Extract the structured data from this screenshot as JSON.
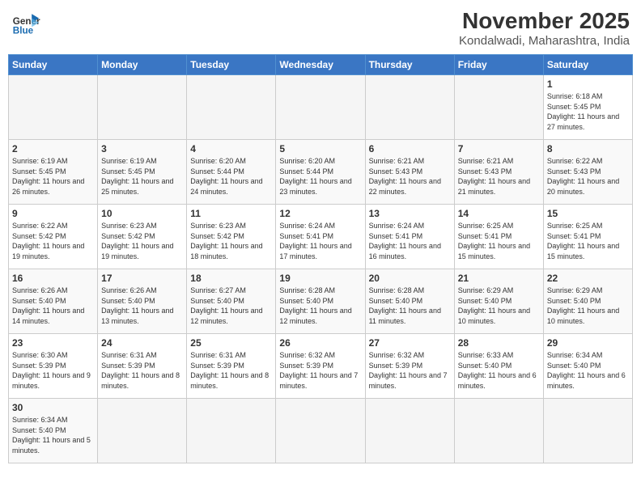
{
  "logo": {
    "text_general": "General",
    "text_blue": "Blue"
  },
  "title": "November 2025",
  "location": "Kondalwadi, Maharashtra, India",
  "weekdays": [
    "Sunday",
    "Monday",
    "Tuesday",
    "Wednesday",
    "Thursday",
    "Friday",
    "Saturday"
  ],
  "weeks": [
    [
      {
        "day": "",
        "empty": true
      },
      {
        "day": "",
        "empty": true
      },
      {
        "day": "",
        "empty": true
      },
      {
        "day": "",
        "empty": true
      },
      {
        "day": "",
        "empty": true
      },
      {
        "day": "",
        "empty": true
      },
      {
        "day": "1",
        "info": "Sunrise: 6:18 AM\nSunset: 5:45 PM\nDaylight: 11 hours\nand 27 minutes."
      }
    ],
    [
      {
        "day": "2",
        "info": "Sunrise: 6:19 AM\nSunset: 5:45 PM\nDaylight: 11 hours\nand 26 minutes."
      },
      {
        "day": "3",
        "info": "Sunrise: 6:19 AM\nSunset: 5:45 PM\nDaylight: 11 hours\nand 25 minutes."
      },
      {
        "day": "4",
        "info": "Sunrise: 6:20 AM\nSunset: 5:44 PM\nDaylight: 11 hours\nand 24 minutes."
      },
      {
        "day": "5",
        "info": "Sunrise: 6:20 AM\nSunset: 5:44 PM\nDaylight: 11 hours\nand 23 minutes."
      },
      {
        "day": "6",
        "info": "Sunrise: 6:21 AM\nSunset: 5:43 PM\nDaylight: 11 hours\nand 22 minutes."
      },
      {
        "day": "7",
        "info": "Sunrise: 6:21 AM\nSunset: 5:43 PM\nDaylight: 11 hours\nand 21 minutes."
      },
      {
        "day": "8",
        "info": "Sunrise: 6:22 AM\nSunset: 5:43 PM\nDaylight: 11 hours\nand 20 minutes."
      }
    ],
    [
      {
        "day": "9",
        "info": "Sunrise: 6:22 AM\nSunset: 5:42 PM\nDaylight: 11 hours\nand 19 minutes."
      },
      {
        "day": "10",
        "info": "Sunrise: 6:23 AM\nSunset: 5:42 PM\nDaylight: 11 hours\nand 19 minutes."
      },
      {
        "day": "11",
        "info": "Sunrise: 6:23 AM\nSunset: 5:42 PM\nDaylight: 11 hours\nand 18 minutes."
      },
      {
        "day": "12",
        "info": "Sunrise: 6:24 AM\nSunset: 5:41 PM\nDaylight: 11 hours\nand 17 minutes."
      },
      {
        "day": "13",
        "info": "Sunrise: 6:24 AM\nSunset: 5:41 PM\nDaylight: 11 hours\nand 16 minutes."
      },
      {
        "day": "14",
        "info": "Sunrise: 6:25 AM\nSunset: 5:41 PM\nDaylight: 11 hours\nand 15 minutes."
      },
      {
        "day": "15",
        "info": "Sunrise: 6:25 AM\nSunset: 5:41 PM\nDaylight: 11 hours\nand 15 minutes."
      }
    ],
    [
      {
        "day": "16",
        "info": "Sunrise: 6:26 AM\nSunset: 5:40 PM\nDaylight: 11 hours\nand 14 minutes."
      },
      {
        "day": "17",
        "info": "Sunrise: 6:26 AM\nSunset: 5:40 PM\nDaylight: 11 hours\nand 13 minutes."
      },
      {
        "day": "18",
        "info": "Sunrise: 6:27 AM\nSunset: 5:40 PM\nDaylight: 11 hours\nand 12 minutes."
      },
      {
        "day": "19",
        "info": "Sunrise: 6:28 AM\nSunset: 5:40 PM\nDaylight: 11 hours\nand 12 minutes."
      },
      {
        "day": "20",
        "info": "Sunrise: 6:28 AM\nSunset: 5:40 PM\nDaylight: 11 hours\nand 11 minutes."
      },
      {
        "day": "21",
        "info": "Sunrise: 6:29 AM\nSunset: 5:40 PM\nDaylight: 11 hours\nand 10 minutes."
      },
      {
        "day": "22",
        "info": "Sunrise: 6:29 AM\nSunset: 5:40 PM\nDaylight: 11 hours\nand 10 minutes."
      }
    ],
    [
      {
        "day": "23",
        "info": "Sunrise: 6:30 AM\nSunset: 5:39 PM\nDaylight: 11 hours\nand 9 minutes."
      },
      {
        "day": "24",
        "info": "Sunrise: 6:31 AM\nSunset: 5:39 PM\nDaylight: 11 hours\nand 8 minutes."
      },
      {
        "day": "25",
        "info": "Sunrise: 6:31 AM\nSunset: 5:39 PM\nDaylight: 11 hours\nand 8 minutes."
      },
      {
        "day": "26",
        "info": "Sunrise: 6:32 AM\nSunset: 5:39 PM\nDaylight: 11 hours\nand 7 minutes."
      },
      {
        "day": "27",
        "info": "Sunrise: 6:32 AM\nSunset: 5:39 PM\nDaylight: 11 hours\nand 7 minutes."
      },
      {
        "day": "28",
        "info": "Sunrise: 6:33 AM\nSunset: 5:40 PM\nDaylight: 11 hours\nand 6 minutes."
      },
      {
        "day": "29",
        "info": "Sunrise: 6:34 AM\nSunset: 5:40 PM\nDaylight: 11 hours\nand 6 minutes."
      }
    ],
    [
      {
        "day": "30",
        "info": "Sunrise: 6:34 AM\nSunset: 5:40 PM\nDaylight: 11 hours\nand 5 minutes."
      },
      {
        "day": "",
        "empty": true
      },
      {
        "day": "",
        "empty": true
      },
      {
        "day": "",
        "empty": true
      },
      {
        "day": "",
        "empty": true
      },
      {
        "day": "",
        "empty": true
      },
      {
        "day": "",
        "empty": true
      }
    ]
  ]
}
